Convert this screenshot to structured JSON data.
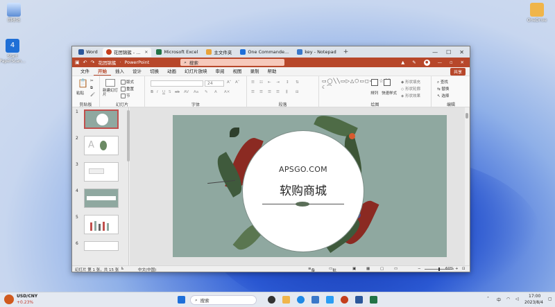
{
  "desktop": {
    "icons": [
      {
        "label": "回收站"
      },
      {
        "label": "Start PaperScan..."
      },
      {
        "label": "OneDrive"
      }
    ]
  },
  "window_tabs": [
    {
      "label": "Word",
      "color": "#2b579a"
    },
    {
      "label": "花团锦簇 - ...",
      "color": "#c43e1c",
      "active": true
    },
    {
      "label": "Microsoft Excel",
      "color": "#217346"
    },
    {
      "label": "主文件夹",
      "color": "#e8a33a"
    },
    {
      "label": "One Commande...",
      "color": "#1e6fd9"
    },
    {
      "label": "key - Notepad",
      "color": "#3a78c9"
    }
  ],
  "titlebar": {
    "doc": "花团锦簇",
    "app": "PowerPoint",
    "search_placeholder": "搜索",
    "accent": "#b7472a"
  },
  "menu": [
    "文件",
    "开始",
    "插入",
    "设计",
    "切换",
    "动画",
    "幻灯片放映",
    "审阅",
    "视图",
    "录制",
    "帮助"
  ],
  "menu_active": "开始",
  "share_label": "共享",
  "ribbon": {
    "groups": [
      "剪贴板",
      "幻灯片",
      "字体",
      "段落",
      "绘图",
      "编辑"
    ],
    "clipboard": {
      "paste": "粘贴"
    },
    "slides": {
      "new": "新建幻灯片",
      "layout": "版式",
      "reset": "重置",
      "section": "节"
    },
    "font_size": "24",
    "drawing": {
      "arrange": "排列",
      "quick_styles": "快速样式",
      "fill": "形状填充",
      "outline": "形状轮廓",
      "effects": "形状效果"
    },
    "editing": {
      "find": "查找",
      "replace": "替换",
      "select": "选择"
    }
  },
  "thumbnails": [
    {
      "num": "1"
    },
    {
      "num": "2"
    },
    {
      "num": "3"
    },
    {
      "num": "4"
    },
    {
      "num": "5"
    },
    {
      "num": "6"
    }
  ],
  "slide": {
    "brand": "APSGO.COM",
    "title": "软购商城",
    "bg": "#8fa8a0"
  },
  "statusbar": {
    "slide_info": "幻灯片 第 1 张，共 15 张",
    "language": "中文(中国)",
    "notes": "备注",
    "comments": "批注",
    "zoom": "60%"
  },
  "taskbar": {
    "search": "搜索",
    "stock_name": "USD/CNY",
    "stock_change": "+0.23%",
    "time": "17:00",
    "date": "2023/8/4"
  }
}
